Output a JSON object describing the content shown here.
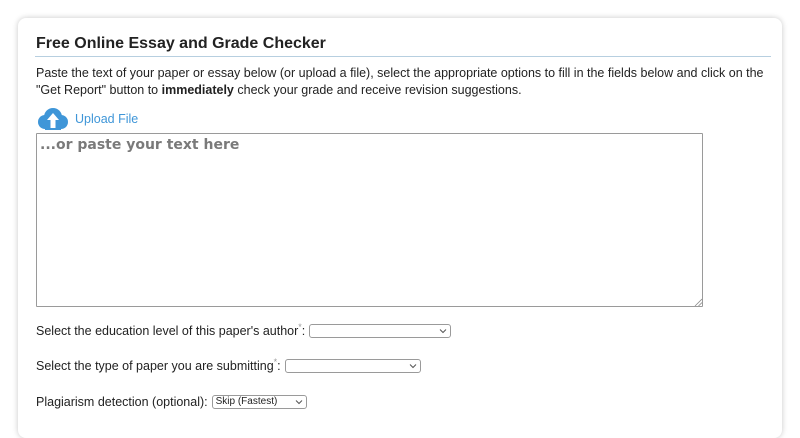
{
  "page": {
    "title": "Free Online Essay and Grade Checker",
    "intro_before": "Paste the text of your paper or essay below (or upload a file), select the appropriate options to fill in the fields below and click on the \"Get Report\" button to ",
    "intro_bold": "immediately",
    "intro_after": " check your grade and receive revision suggestions."
  },
  "upload": {
    "icon": "cloud-upload-icon",
    "label": "Upload File",
    "color": "#3f96d8"
  },
  "essay": {
    "placeholder": "...or paste your text here",
    "value": ""
  },
  "fields": {
    "education_level": {
      "label": "Select the education level of this paper's author",
      "required_mark": "*",
      "suffix": ":",
      "value": ""
    },
    "paper_type": {
      "label": "Select the type of paper you are submitting",
      "required_mark": "*",
      "suffix": ":",
      "value": ""
    },
    "plagiarism": {
      "label": "Plagiarism detection (optional):",
      "value": "Skip (Fastest)"
    }
  },
  "colors": {
    "title_rule": "#b7cfe0",
    "accent": "#3f96d8",
    "placeholder": "#7a7a7a"
  }
}
